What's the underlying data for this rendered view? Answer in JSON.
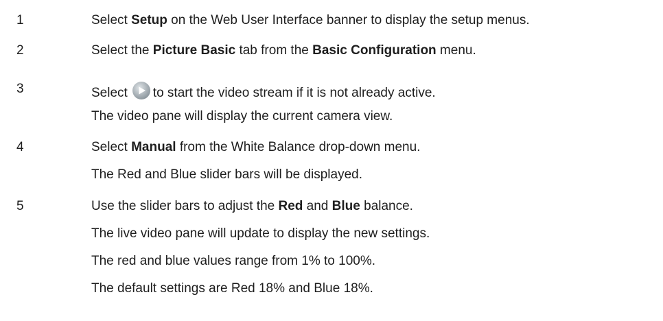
{
  "steps": [
    {
      "number": "1",
      "parts": [
        "Select ",
        "Setup",
        " on the Web User Interface banner to display the setup menus."
      ]
    },
    {
      "number": "2",
      "parts": [
        "Select the ",
        "Picture Basic",
        " tab from the ",
        "Basic Configuration",
        " menu."
      ]
    },
    {
      "number": "3",
      "parts": [
        "Select",
        "to start the video stream if it is not already active."
      ],
      "notes": [
        "The video pane will display the current camera view."
      ]
    },
    {
      "number": "4",
      "parts": [
        "Select ",
        "Manual",
        " from the White Balance drop-down menu."
      ],
      "notes": [
        "The Red and Blue slider bars will be displayed."
      ]
    },
    {
      "number": "5",
      "parts": [
        "Use the slider bars to adjust the ",
        "Red",
        " and ",
        "Blue",
        " balance."
      ],
      "notes": [
        "The live video pane will update to display the new settings.",
        "The red and blue values range from 1% to 100%.",
        "The default settings are Red 18% and Blue 18%."
      ]
    }
  ],
  "icons": {
    "play": "play-icon"
  },
  "colors": {
    "text": "#1e1e1e",
    "icon_fill": "#a9b2b8",
    "icon_arrow": "#ffffff"
  }
}
